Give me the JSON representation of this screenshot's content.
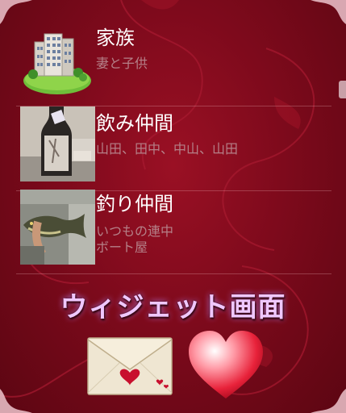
{
  "list": {
    "items": [
      {
        "title": "家族",
        "subtitle": "妻と子供",
        "icon": "building-icon"
      },
      {
        "title": "飲み仲間",
        "subtitle": "山田、田中、中山、山田",
        "icon": "sake-bottle-photo"
      },
      {
        "title": "釣り仲間",
        "subtitle": "いつもの連中\nボート屋",
        "icon": "fish-photo"
      }
    ]
  },
  "footer": {
    "title": "ウィジェット画面",
    "mail_icon": "envelope-heart-icon",
    "heart_icon": "heart-icon"
  },
  "colors": {
    "background": "#7e0a1c",
    "title_text": "#ffffff",
    "subtitle_text": "#b58088",
    "widget_title": "#efc8ff"
  }
}
